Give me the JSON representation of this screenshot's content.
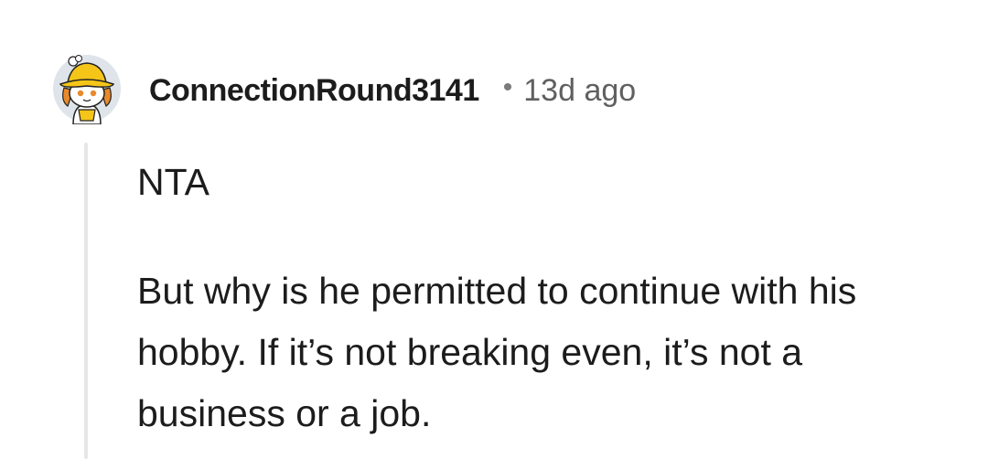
{
  "comment": {
    "username": "ConnectionRound3141",
    "separator": "•",
    "timestamp": "13d ago",
    "body": {
      "paragraphs": [
        "NTA",
        "But why is he permitted to continue with his hobby. If it’s not breaking even, it’s not a business or a job."
      ]
    }
  },
  "colors": {
    "text": "#1c1c1c",
    "meta": "#606060",
    "thread_line": "#e6e6e6",
    "avatar_bg": "#dfe4ea",
    "hat": "#f5c518"
  },
  "icons": {
    "avatar": "snoo-avatar-yellow-hat-icon"
  }
}
